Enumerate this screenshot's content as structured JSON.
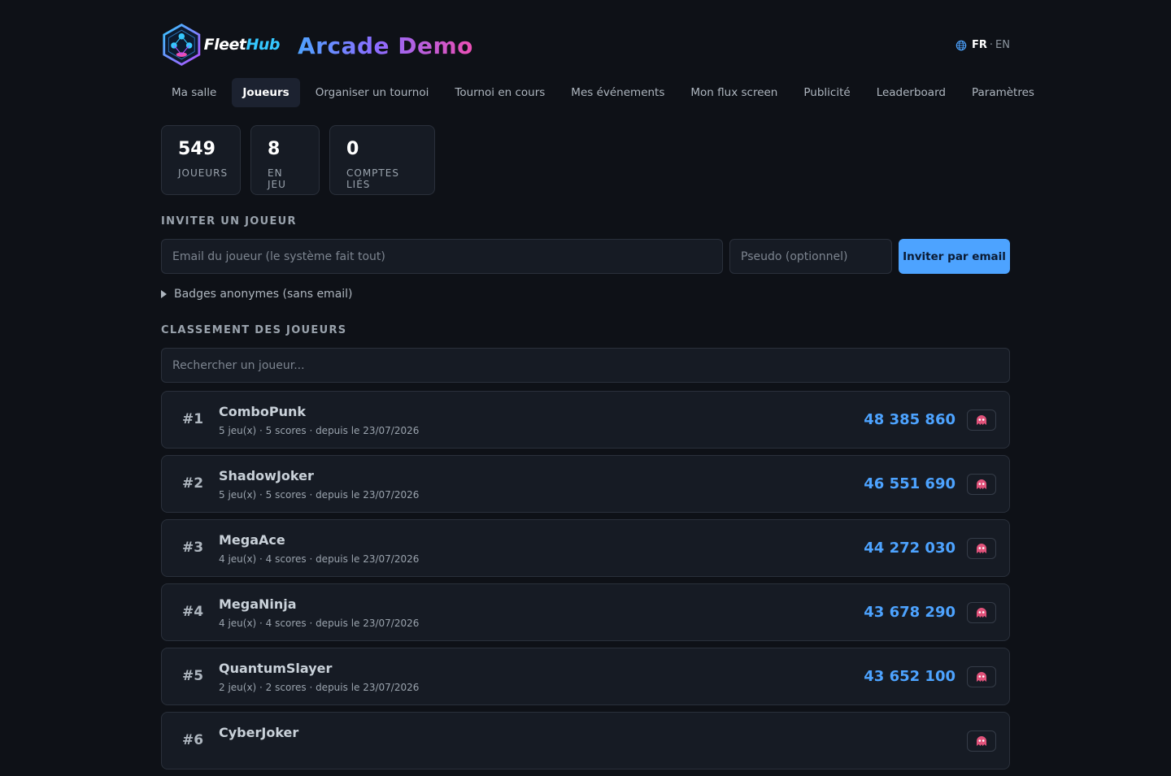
{
  "header": {
    "logo_text_a": "Fleet",
    "logo_text_b": "Hub",
    "app_title": "Arcade Demo",
    "lang_active": "FR",
    "lang_other": "EN",
    "lang_separator": "·"
  },
  "nav": {
    "items": [
      {
        "label": "Ma salle"
      },
      {
        "label": "Joueurs",
        "active": true
      },
      {
        "label": "Organiser un tournoi"
      },
      {
        "label": "Tournoi en cours"
      },
      {
        "label": "Mes événements"
      },
      {
        "label": "Mon flux screen"
      },
      {
        "label": "Publicité"
      },
      {
        "label": "Leaderboard"
      },
      {
        "label": "Paramètres"
      }
    ]
  },
  "stats": [
    {
      "value": "549",
      "label": "JOUEURS"
    },
    {
      "value": "8",
      "label": "EN JEU"
    },
    {
      "value": "0",
      "label": "COMPTES LIÉS"
    }
  ],
  "invite": {
    "title": "INVITER UN JOUEUR",
    "email_placeholder": "Email du joueur (le système fait tout)",
    "pseudo_placeholder": "Pseudo (optionnel)",
    "button_label": "Inviter par email",
    "anonymous_label": "Badges anonymes (sans email)"
  },
  "ranking": {
    "title": "CLASSEMENT DES JOUEURS",
    "search_placeholder": "Rechercher un joueur...",
    "players": [
      {
        "rank": "#1",
        "name": "ComboPunk",
        "meta": "5 jeu(x) · 5 scores · depuis le 23/07/2026",
        "score": "48 385 860"
      },
      {
        "rank": "#2",
        "name": "ShadowJoker",
        "meta": "5 jeu(x) · 5 scores · depuis le 23/07/2026",
        "score": "46 551 690"
      },
      {
        "rank": "#3",
        "name": "MegaAce",
        "meta": "4 jeu(x) · 4 scores · depuis le 23/07/2026",
        "score": "44 272 030"
      },
      {
        "rank": "#4",
        "name": "MegaNinja",
        "meta": "4 jeu(x) · 4 scores · depuis le 23/07/2026",
        "score": "43 678 290"
      },
      {
        "rank": "#5",
        "name": "QuantumSlayer",
        "meta": "2 jeu(x) · 2 scores · depuis le 23/07/2026",
        "score": "43 652 100"
      },
      {
        "rank": "#6",
        "name": "CyberJoker",
        "meta": "",
        "score": ""
      }
    ]
  },
  "colors": {
    "background": "#0e1117",
    "card": "#161b24",
    "accent": "#4da3ff",
    "title_gradient_start": "#4fa3ff",
    "title_gradient_end": "#ec4fb4"
  },
  "icons": {
    "lang": "globe-icon",
    "player_action": "arcade-ghost-icon"
  }
}
